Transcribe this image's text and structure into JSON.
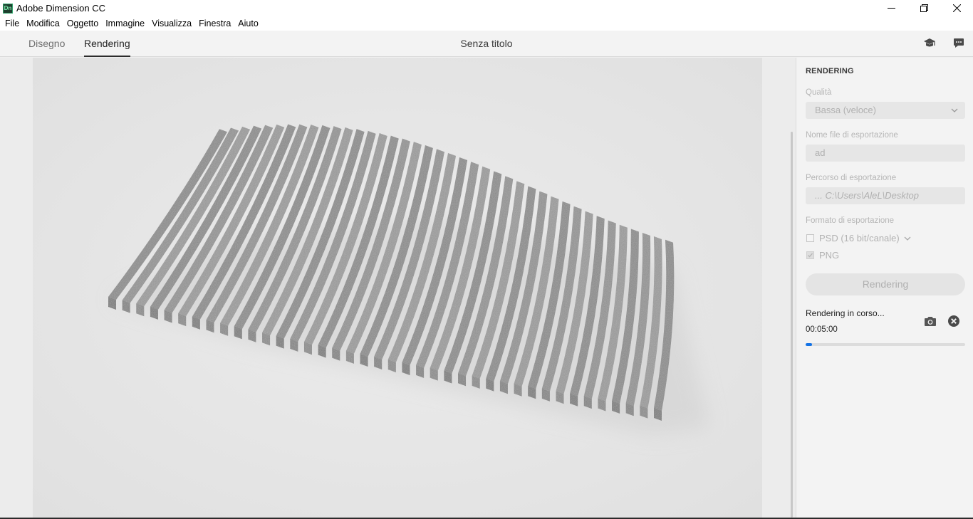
{
  "window": {
    "app_icon_text": "Dn",
    "title": "Adobe Dimension CC"
  },
  "menu": [
    "File",
    "Modifica",
    "Oggetto",
    "Immagine",
    "Visualizza",
    "Finestra",
    "Aiuto"
  ],
  "modes": {
    "design": "Disegno",
    "render": "Rendering",
    "active": "Rendering"
  },
  "document": {
    "title": "Senza titolo"
  },
  "icons": {
    "learn": "graduation-cap-icon",
    "feedback": "chat-bubble-icon",
    "snapshot": "camera-icon",
    "cancel": "close-circle-icon"
  },
  "panel": {
    "heading": "RENDERING",
    "quality_label": "Qualità",
    "quality_value": "Bassa (veloce)",
    "filename_label": "Nome file di esportazione",
    "filename_value": "ad",
    "path_label": "Percorso di esportazione",
    "path_value": "... C:\\Users\\AleL\\Desktop",
    "format_label": "Formato di esportazione",
    "format_psd": "PSD (16 bit/canale)",
    "format_psd_checked": false,
    "format_png": "PNG",
    "format_png_checked": true,
    "render_button": "Rendering",
    "status": "Rendering in corso...",
    "elapsed": "00:05:00",
    "progress_fraction": 0.04
  },
  "colors": {
    "accent": "#1473e6",
    "canvas": "#e3e3e3",
    "panel": "#f3f3f3"
  }
}
